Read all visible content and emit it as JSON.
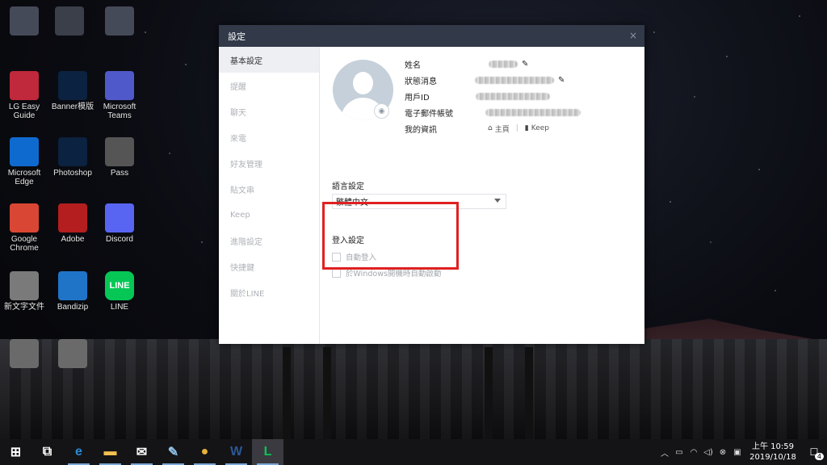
{
  "desktop": {
    "icons": [
      {
        "label": "",
        "color": "#444a58"
      },
      {
        "label": "",
        "color": "#3b3f49"
      },
      {
        "label": "",
        "color": "#444a58"
      },
      {
        "label": "LG Easy Guide",
        "color": "#c0283b"
      },
      {
        "label": "Banner模版",
        "color": "#0b2240"
      },
      {
        "label": "Microsoft Teams",
        "color": "#5059c9"
      },
      {
        "label": "Microsoft Edge",
        "color": "#0f6ad0"
      },
      {
        "label": "Photoshop",
        "color": "#0b2240"
      },
      {
        "label": "Pass",
        "color": "#555"
      },
      {
        "label": "Google Chrome",
        "color": "#d94633"
      },
      {
        "label": "Adobe",
        "color": "#b41e1e"
      },
      {
        "label": "Discord",
        "color": "#5865f2"
      },
      {
        "label": "新文字文件",
        "color": "#7a7a7a"
      },
      {
        "label": "Bandizip",
        "color": "#1f74c8"
      },
      {
        "label": "LINE",
        "color": "#06c755"
      },
      {
        "label": "",
        "color": "#6a6a6a"
      },
      {
        "label": "",
        "color": "#6a6a6a"
      }
    ],
    "line_icon_text": "LINE"
  },
  "dialog": {
    "title": "設定",
    "close_glyph": "×",
    "sidebar": [
      {
        "label": "基本設定",
        "active": true
      },
      {
        "label": "提醒"
      },
      {
        "label": "聊天"
      },
      {
        "label": "來電"
      },
      {
        "label": "好友管理"
      },
      {
        "label": "貼文串"
      },
      {
        "label": "Keep"
      },
      {
        "label": "進階設定"
      },
      {
        "label": "快捷鍵"
      },
      {
        "label": "關於LINE"
      }
    ],
    "profile": {
      "name_label": "姓名",
      "status_label": "狀態消息",
      "userid_label": "用戶ID",
      "email_label": "電子郵件帳號",
      "myinfo_label": "我的資訊",
      "home_link": "主頁",
      "keep_link": "Keep"
    },
    "language": {
      "title": "語言設定",
      "selected": "繁體中文"
    },
    "login": {
      "title": "登入設定",
      "auto_login": "自動登入",
      "auto_start": "於Windows開機時自動啟動"
    }
  },
  "taskbar": {
    "apps": [
      {
        "name": "start-button",
        "glyph": "⊞",
        "color": "#ffffff"
      },
      {
        "name": "task-view-button",
        "glyph": "⧉",
        "color": "#ffffff"
      },
      {
        "name": "edge-taskbar",
        "glyph": "e",
        "color": "#2a8ad4"
      },
      {
        "name": "file-explorer-taskbar",
        "glyph": "▬",
        "color": "#f2c14e"
      },
      {
        "name": "mail-taskbar",
        "glyph": "✉",
        "color": "#ffffff"
      },
      {
        "name": "notes-taskbar",
        "glyph": "✎",
        "color": "#8fc1e8"
      },
      {
        "name": "chrome-taskbar",
        "glyph": "●",
        "color": "#e5b33a"
      },
      {
        "name": "word-taskbar",
        "glyph": "W",
        "color": "#2b5797"
      },
      {
        "name": "line-taskbar",
        "glyph": "L",
        "color": "#06c755"
      }
    ],
    "time": "上午 10:59",
    "date": "2019/10/18",
    "notification_count": "4"
  }
}
